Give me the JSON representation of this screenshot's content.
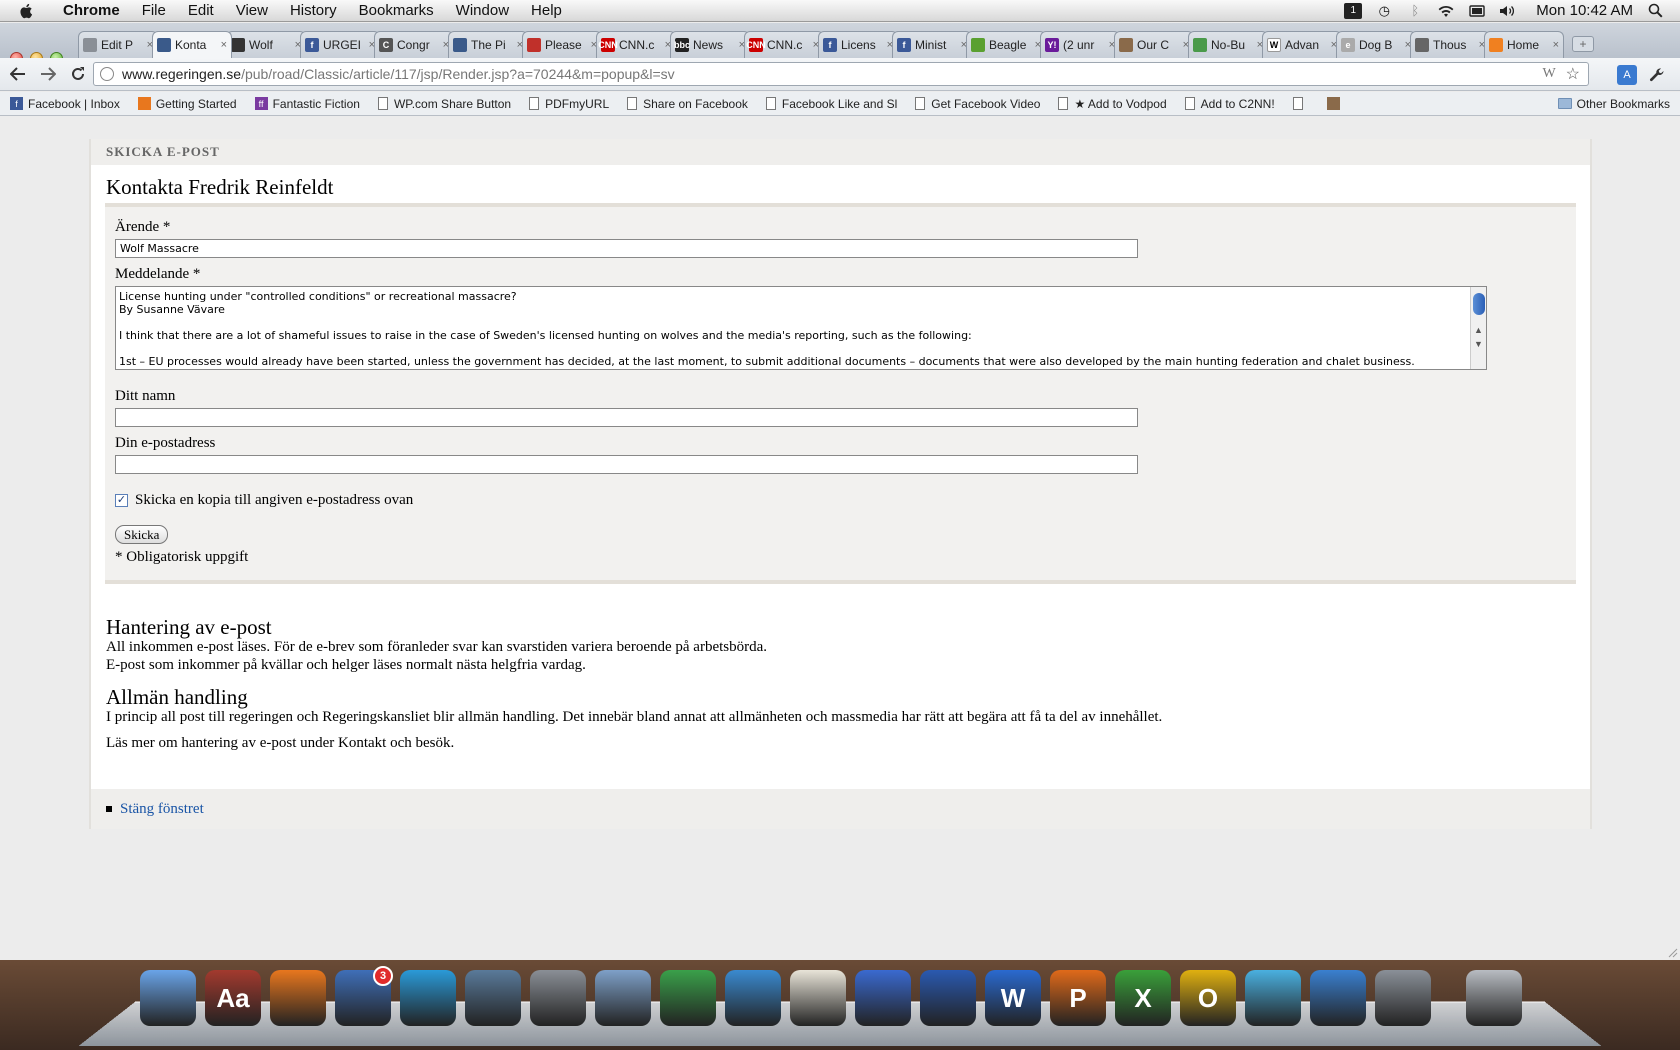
{
  "menubar": {
    "app": "Chrome",
    "menus": [
      "File",
      "Edit",
      "View",
      "History",
      "Bookmarks",
      "Window",
      "Help"
    ],
    "clock": "Mon 10:42 AM"
  },
  "tabs": [
    {
      "label": "Edit P",
      "icon": "page-icon"
    },
    {
      "label": "Konta",
      "icon": "regeringen-icon",
      "active": true
    },
    {
      "label": "Wolf",
      "icon": "wolf-icon"
    },
    {
      "label": "URGEI",
      "icon": "facebook-icon"
    },
    {
      "label": "Congr",
      "icon": "c-icon"
    },
    {
      "label": "The Pi",
      "icon": "regeringen-icon"
    },
    {
      "label": "Please",
      "icon": "red-icon"
    },
    {
      "label": "CNN.c",
      "icon": "cnn-icon"
    },
    {
      "label": "News",
      "icon": "bbc-icon"
    },
    {
      "label": "CNN.c",
      "icon": "cnn-icon"
    },
    {
      "label": "Licens",
      "icon": "facebook-icon"
    },
    {
      "label": "Minist",
      "icon": "facebook-icon"
    },
    {
      "label": "Beagle",
      "icon": "green-icon"
    },
    {
      "label": "(2 unr",
      "icon": "yahoo-icon"
    },
    {
      "label": "Our C",
      "icon": "image-icon"
    },
    {
      "label": "No-Bu",
      "icon": "chat-icon"
    },
    {
      "label": "Advan",
      "icon": "wikipedia-icon"
    },
    {
      "label": "Dog B",
      "icon": "e-icon"
    },
    {
      "label": "Thous",
      "icon": "thous-icon"
    },
    {
      "label": "Home",
      "icon": "orange-icon"
    }
  ],
  "address": {
    "host": "www.regeringen.se",
    "path": "/pub/road/Classic/article/117/jsp/Render.jsp?a=70244&m=popup&l=sv"
  },
  "bookmarks": [
    {
      "label": "Facebook | Inbox",
      "icon": "facebook-icon"
    },
    {
      "label": "Getting Started",
      "icon": "firefox-icon"
    },
    {
      "label": "Fantastic Fiction",
      "icon": "ff-icon"
    },
    {
      "label": "WP.com Share Button",
      "icon": "page-icon"
    },
    {
      "label": "PDFmyURL",
      "icon": "page-icon"
    },
    {
      "label": "Share on Facebook",
      "icon": "page-icon"
    },
    {
      "label": "Facebook Like and Sl",
      "icon": "page-icon"
    },
    {
      "label": "Get Facebook Video",
      "icon": "page-icon"
    },
    {
      "label": "★ Add to Vodpod",
      "icon": "page-icon"
    },
    {
      "label": "Add to C2NN!",
      "icon": "page-icon"
    },
    {
      "label": "",
      "icon": "page-icon"
    },
    {
      "label": "",
      "icon": "image-icon"
    }
  ],
  "other_bookmarks": "Other Bookmarks",
  "page": {
    "section_header": "SKICKA E-POST",
    "title": "Kontakta Fredrik Reinfeldt",
    "form": {
      "subject_label": "Ärende *",
      "subject_value": "Wolf Massacre",
      "message_label": "Meddelande *",
      "message_value": "License hunting under \"controlled conditions\" or recreational massacre?\nBy Susanne Vävare\n\nI think that there are a lot of shameful issues to raise in the case of Sweden's licensed hunting on wolves and the media's reporting, such as the following:\n\n1st – EU processes would already have been started, unless the government has decided, at the last moment, to submit additional documents – documents that were also developed by the main hunting federation and chalet business. Suddenly, they",
      "name_label": "Ditt namn",
      "name_value": "",
      "email_label": "Din e-postadress",
      "email_value": "",
      "copy_label": "Skicka en kopia till angiven e-postadress ovan",
      "copy_checked": true,
      "submit_label": "Skicka",
      "required_note": "* Obligatorisk uppgift"
    },
    "info": {
      "h1": "Hantering av e-post",
      "p1": "All inkommen e-post läses. För de e-brev som föranleder svar kan svarstiden variera beroende på arbetsbörda.",
      "p2": "E-post som inkommer på kvällar och helger läses normalt nästa helgfria vardag.",
      "h2": "Allmän handling",
      "p3": "I princip all post till regeringen och Regeringskansliet blir allmän handling. Det innebär bland annat att allmänheten och massmedia har rätt att begära att få ta del av innehållet.",
      "p4": "Läs mer om hantering av e-post under Kontakt och besök."
    },
    "footer_link": "Stäng fönstret"
  },
  "dock": [
    {
      "name": "finder-icon",
      "color": "#6aa4e8"
    },
    {
      "name": "dictionary-icon",
      "color": "#a33a2e",
      "text": "Aa"
    },
    {
      "name": "firefox-icon",
      "color": "#e8771e"
    },
    {
      "name": "thunderbird-icon",
      "color": "#3f6fb8",
      "badge": "3"
    },
    {
      "name": "flip-video-icon",
      "color": "#2a9ad8"
    },
    {
      "name": "iphoto-icon",
      "color": "#5a7a9a"
    },
    {
      "name": "system-preferences-icon",
      "color": "#8a8f96"
    },
    {
      "name": "preview-icon",
      "color": "#7ea0c8"
    },
    {
      "name": "chrome-icon",
      "color": "#3aa04a"
    },
    {
      "name": "safari-icon",
      "color": "#3a8ad0"
    },
    {
      "name": "textedit-icon",
      "color": "#e8e4d8"
    },
    {
      "name": "itunes-icon",
      "color": "#3a6ad0"
    },
    {
      "name": "quicktime-icon",
      "color": "#2a5ab0"
    },
    {
      "name": "word-icon",
      "color": "#2a6ad0",
      "text": "W"
    },
    {
      "name": "powerpoint-icon",
      "color": "#e06a1a",
      "text": "P"
    },
    {
      "name": "excel-icon",
      "color": "#3aa03a",
      "text": "X"
    },
    {
      "name": "outlook-icon",
      "color": "#e0b010",
      "text": "O"
    },
    {
      "name": "messenger-icon",
      "color": "#4ab0e0"
    },
    {
      "name": "download-icon",
      "color": "#3a80d0"
    },
    {
      "name": "remote-desktop-icon",
      "color": "#8a9098"
    },
    {
      "name": "trash-icon",
      "color": "#b8bcc2",
      "gap": true
    }
  ]
}
